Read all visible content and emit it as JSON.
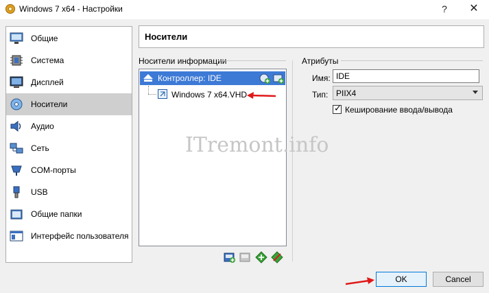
{
  "window": {
    "title": "Windows 7 x64 - Настройки",
    "help_glyph": "?",
    "close_glyph": "✕"
  },
  "sidebar": {
    "items": [
      {
        "label": "Общие",
        "icon": "monitor-general-icon"
      },
      {
        "label": "Система",
        "icon": "chip-system-icon"
      },
      {
        "label": "Дисплей",
        "icon": "display-icon"
      },
      {
        "label": "Носители",
        "icon": "storage-disc-icon",
        "selected": true
      },
      {
        "label": "Аудио",
        "icon": "speaker-icon"
      },
      {
        "label": "Сеть",
        "icon": "network-icon"
      },
      {
        "label": "COM-порты",
        "icon": "serial-port-icon"
      },
      {
        "label": "USB",
        "icon": "usb-icon"
      },
      {
        "label": "Общие папки",
        "icon": "shared-folder-icon"
      },
      {
        "label": "Интерфейс пользователя",
        "icon": "user-interface-icon"
      }
    ]
  },
  "page": {
    "title": "Носители"
  },
  "storage": {
    "section_label": "Носители информации",
    "controller_label": "Контроллер: IDE",
    "disk_label": "Windows 7 x64.VHD"
  },
  "attributes": {
    "section_label": "Атрибуты",
    "name_label": "Имя:",
    "name_value": "IDE",
    "type_label": "Тип:",
    "type_value": "PIIX4",
    "cache_label": "Кеширование ввода/вывода",
    "cache_checked": true
  },
  "watermark": "ITremont.info",
  "footer": {
    "ok_label": "OK",
    "cancel_label": "Cancel"
  },
  "colors": {
    "selection_blue": "#3d7ad6",
    "annotation_red": "#e01818",
    "ok_border": "#0078d7"
  }
}
